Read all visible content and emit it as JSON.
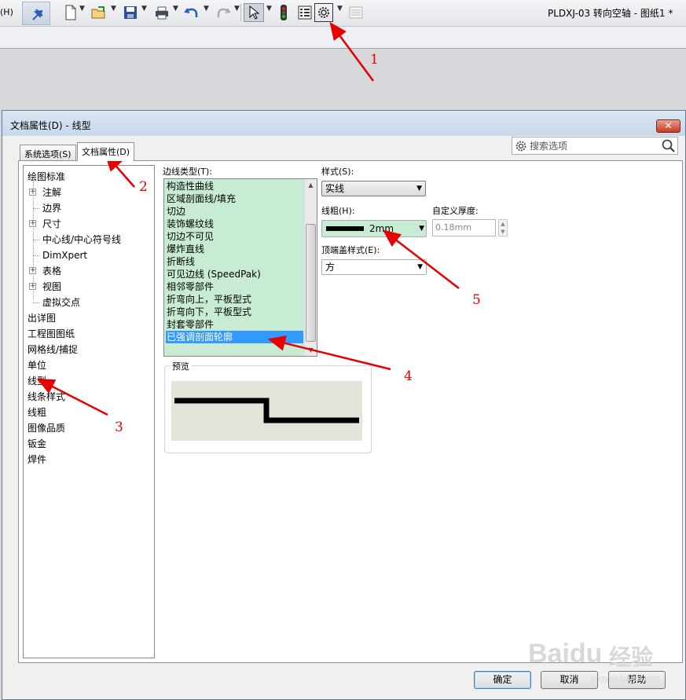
{
  "toolbar": {
    "menu_fragment": "(H)",
    "document_title": "PLDXJ-03 转向空轴 - 图纸1 *",
    "icons": [
      "pin-icon",
      "new-document-icon",
      "open-folder-icon",
      "save-icon",
      "print-icon",
      "undo-icon",
      "redo-icon",
      "select-pointer-icon",
      "traffic-light-icon",
      "file-properties-icon",
      "options-gear-icon",
      "customize-icon"
    ]
  },
  "dialog": {
    "title": "文档属性(D) - 线型",
    "close_label": "✕",
    "search_placeholder": "搜索选项",
    "tabs": [
      {
        "label": "系统选项(S)",
        "active": false
      },
      {
        "label": "文档属性(D)",
        "active": true
      }
    ],
    "tree": [
      {
        "label": "绘图标准",
        "level": 0,
        "expander": false
      },
      {
        "label": "注解",
        "level": 1,
        "expander": true
      },
      {
        "label": "边界",
        "level": 1,
        "expander": false
      },
      {
        "label": "尺寸",
        "level": 1,
        "expander": true
      },
      {
        "label": "中心线/中心符号线",
        "level": 1,
        "expander": false
      },
      {
        "label": "DimXpert",
        "level": 1,
        "expander": false
      },
      {
        "label": "表格",
        "level": 1,
        "expander": true
      },
      {
        "label": "视图",
        "level": 1,
        "expander": true
      },
      {
        "label": "虚拟交点",
        "level": 1,
        "expander": false
      },
      {
        "label": "出详图",
        "level": 0,
        "expander": false
      },
      {
        "label": "工程图图纸",
        "level": 0,
        "expander": false
      },
      {
        "label": "网格线/捕捉",
        "level": 0,
        "expander": false
      },
      {
        "label": "单位",
        "level": 0,
        "expander": false
      },
      {
        "label": "线型",
        "level": 0,
        "expander": false
      },
      {
        "label": "线条样式",
        "level": 0,
        "expander": false
      },
      {
        "label": "线粗",
        "level": 0,
        "expander": false
      },
      {
        "label": "图像品质",
        "level": 0,
        "expander": false
      },
      {
        "label": "钣金",
        "level": 0,
        "expander": false
      },
      {
        "label": "焊件",
        "level": 0,
        "expander": false
      }
    ],
    "edge_type": {
      "label": "边线类型(T):",
      "items": [
        "构造性曲线",
        "区域剖面线/填充",
        "切边",
        "装饰螺纹线",
        "切边不可见",
        "爆炸直线",
        "折断线",
        "可见边线 (SpeedPak)",
        "相邻零部件",
        "折弯向上，平板型式",
        "折弯向下，平板型式",
        "封套零部件",
        "已强调剖面轮廓"
      ],
      "selected_index": 12
    },
    "style": {
      "label": "样式(S):",
      "value": "实线"
    },
    "thickness": {
      "label": "线粗(H):",
      "value": "2mm"
    },
    "custom_thickness": {
      "label": "自定义厚度:",
      "value": "0.18mm"
    },
    "end_cap": {
      "label": "顶端盖样式(E):",
      "value": "方"
    },
    "preview_label": "预览",
    "buttons": {
      "ok": "确定",
      "cancel": "取消",
      "help": "帮助"
    }
  },
  "annotations": [
    "1",
    "2",
    "3",
    "4",
    "5"
  ],
  "watermark": {
    "brand": "Baidu",
    "sub": "经验",
    "url": "jingyan.baidu.com"
  },
  "colors": {
    "accent_red": "#e60000",
    "list_bg": "#c8ecd3",
    "selection": "#3399ff"
  }
}
